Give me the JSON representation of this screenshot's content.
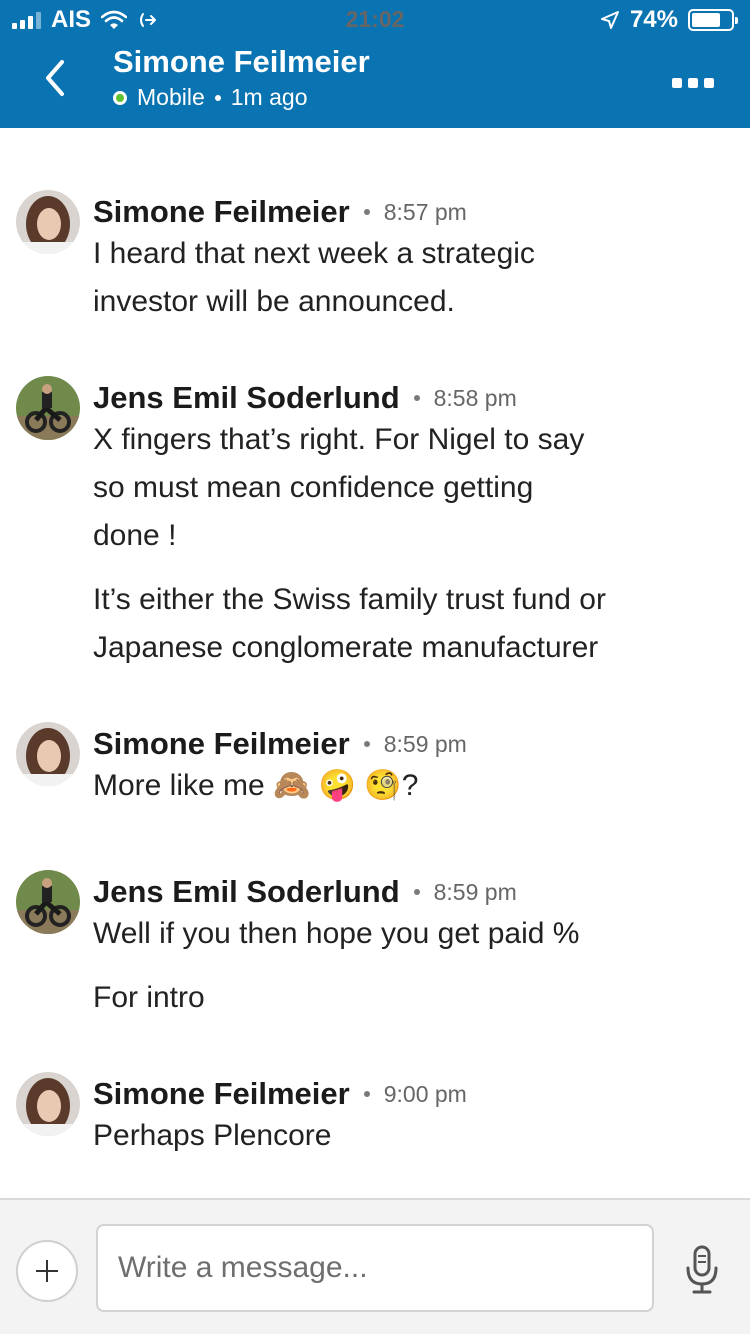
{
  "status_bar": {
    "carrier": "AIS",
    "time": "21:02",
    "battery": "74%",
    "battery_level": 0.74
  },
  "header": {
    "title": "Simone Feilmeier",
    "presence": "Mobile",
    "last_seen": "1m ago"
  },
  "messages": [
    {
      "name": "Simone Feilmeier",
      "time": "8:57 pm",
      "avatar": "simone-avatar",
      "lines": [
        "I heard that next week a strategic",
        "investor will be announced."
      ]
    },
    {
      "name": "Jens Emil Soderlund",
      "time": "8:58 pm",
      "avatar": "jens-avatar",
      "lines": [
        "X fingers that’s right. For Nigel to say",
        "so must mean confidence getting",
        "done !"
      ],
      "extra": [
        "It’s either the Swiss family trust fund or",
        "Japanese conglomerate manufacturer"
      ]
    },
    {
      "name": "Simone Feilmeier",
      "time": "8:59 pm",
      "avatar": "simone-avatar",
      "text": "More like me 🙈 🤪 🧐?"
    },
    {
      "name": "Jens Emil Soderlund",
      "time": "8:59 pm",
      "avatar": "jens-avatar",
      "text": "Well if you then hope you get paid %",
      "extra_text": "For intro"
    },
    {
      "name": "Simone Feilmeier",
      "time": "9:00 pm",
      "avatar": "simone-avatar",
      "text": "Perhaps Plencore"
    }
  ],
  "composer": {
    "placeholder": "Write a message..."
  },
  "colors": {
    "header_bg": "#0a73b1",
    "presence": "#5ec232"
  }
}
